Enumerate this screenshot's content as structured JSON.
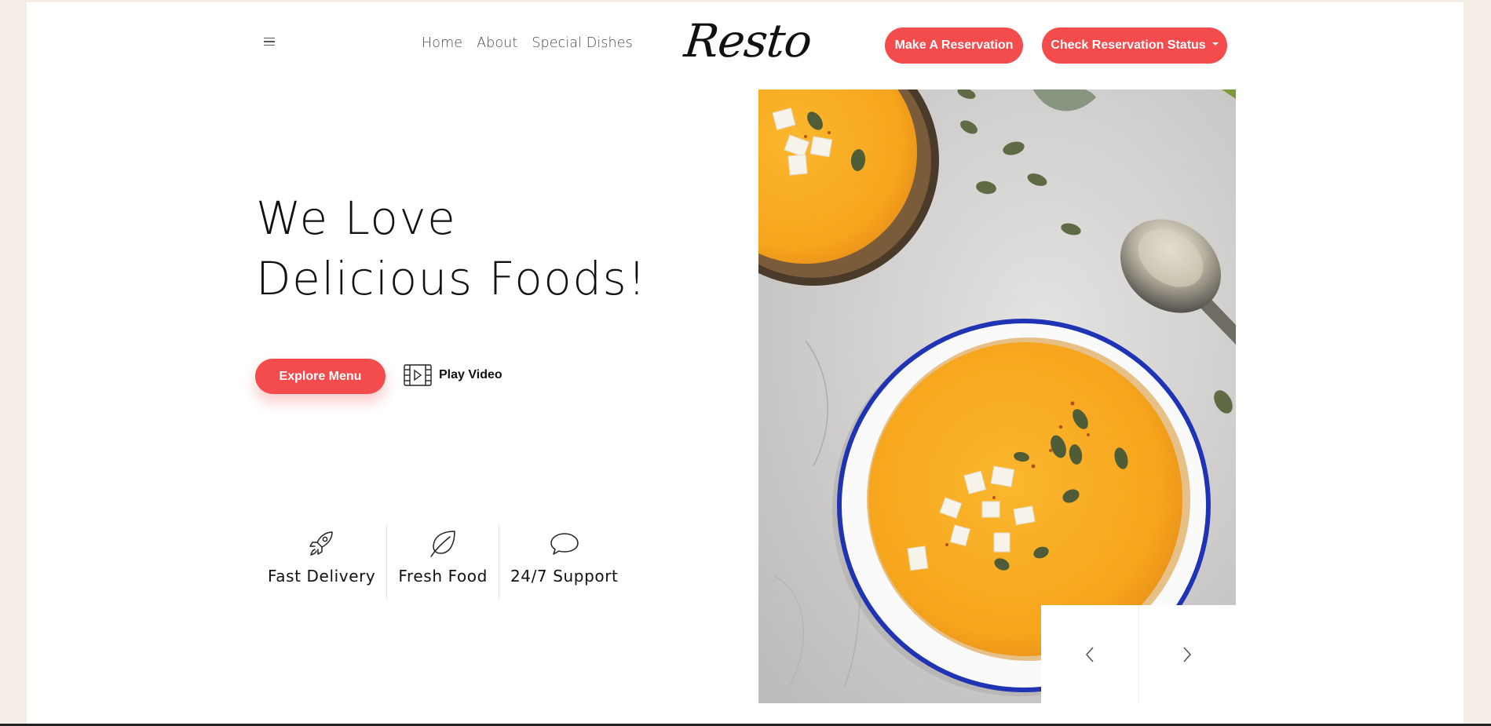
{
  "header": {
    "menu_icon": "hamburger-icon",
    "nav": [
      "Home",
      "About",
      "Special Dishes"
    ],
    "logo": "Resto",
    "reserve_button": "Make A Reservation",
    "status_button": "Check Reservation Status",
    "status_button_icon": "caret-down-icon"
  },
  "hero": {
    "title_line1": "We Love",
    "title_line2": "Delicious Foods!",
    "explore_button": "Explore Menu",
    "play_video": "Play Video",
    "play_video_icon": "video-play-icon"
  },
  "features": [
    {
      "label": "Fast Delivery",
      "icon": "rocket-icon"
    },
    {
      "label": "Fresh Food",
      "icon": "leaf-icon"
    },
    {
      "label": "24/7 Support",
      "icon": "chat-bubble-icon"
    }
  ],
  "slider": {
    "image": "pumpkin-soup-bowls",
    "prev_icon": "chevron-left-icon",
    "next_icon": "chevron-right-icon"
  },
  "colors": {
    "accent": "#f44b4d",
    "page_bg": "#f4ede6",
    "soup": "#f7a821"
  }
}
